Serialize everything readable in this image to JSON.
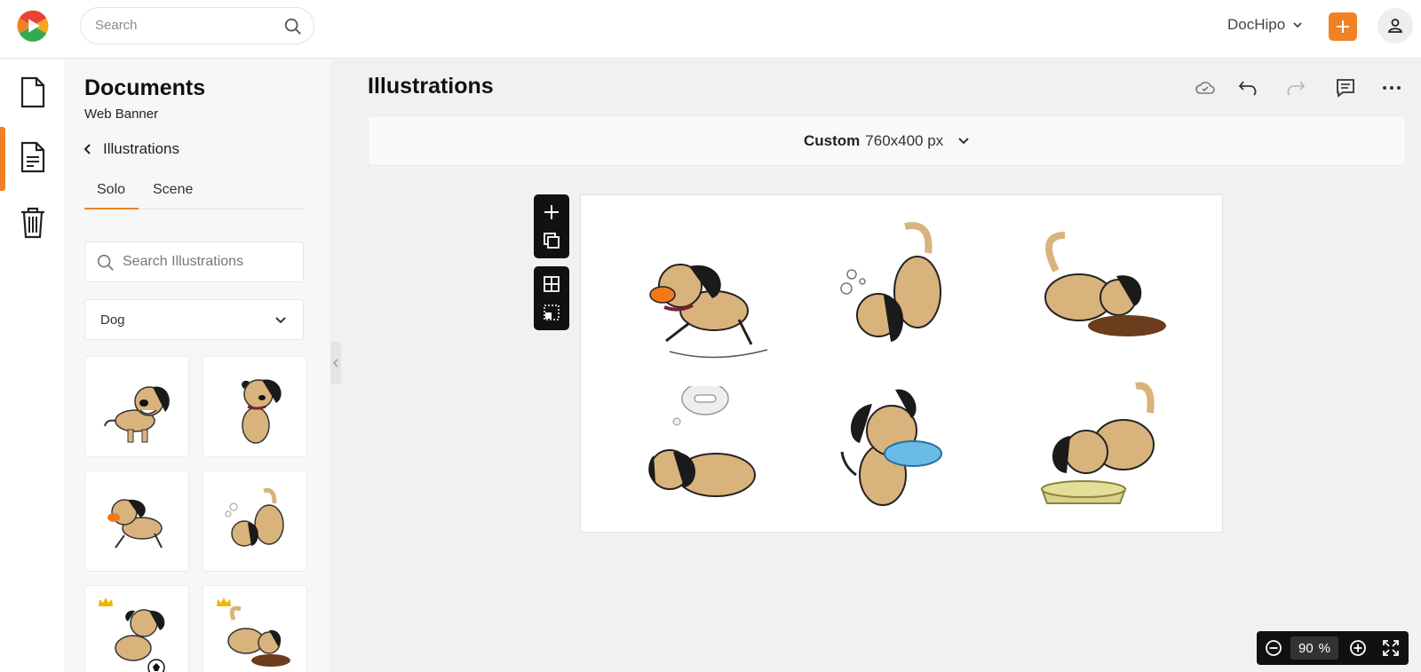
{
  "topbar": {
    "search_placeholder": "Search",
    "account_name": "DocHipo"
  },
  "panel": {
    "title": "Documents",
    "subtitle": "Web Banner",
    "back_label": "Illustrations",
    "tabs": [
      {
        "label": "Solo"
      },
      {
        "label": "Scene"
      }
    ],
    "search_placeholder": "Search Illustrations",
    "category": "Dog"
  },
  "main": {
    "title": "Illustrations",
    "size_preset": "Custom",
    "size_value": "760x400 px"
  },
  "zoom": {
    "value": "90",
    "unit": "%"
  },
  "colors": {
    "accent": "#f08125",
    "dog_fur": "#d9b37c",
    "dog_ear": "#1a1a1a",
    "collar": "#7a2230"
  },
  "icons": {
    "rail": [
      "document-icon",
      "template-icon",
      "trash-icon"
    ],
    "toolbar": [
      "cloud-check-icon",
      "undo-icon",
      "redo-icon",
      "comment-icon",
      "more-icon"
    ]
  }
}
